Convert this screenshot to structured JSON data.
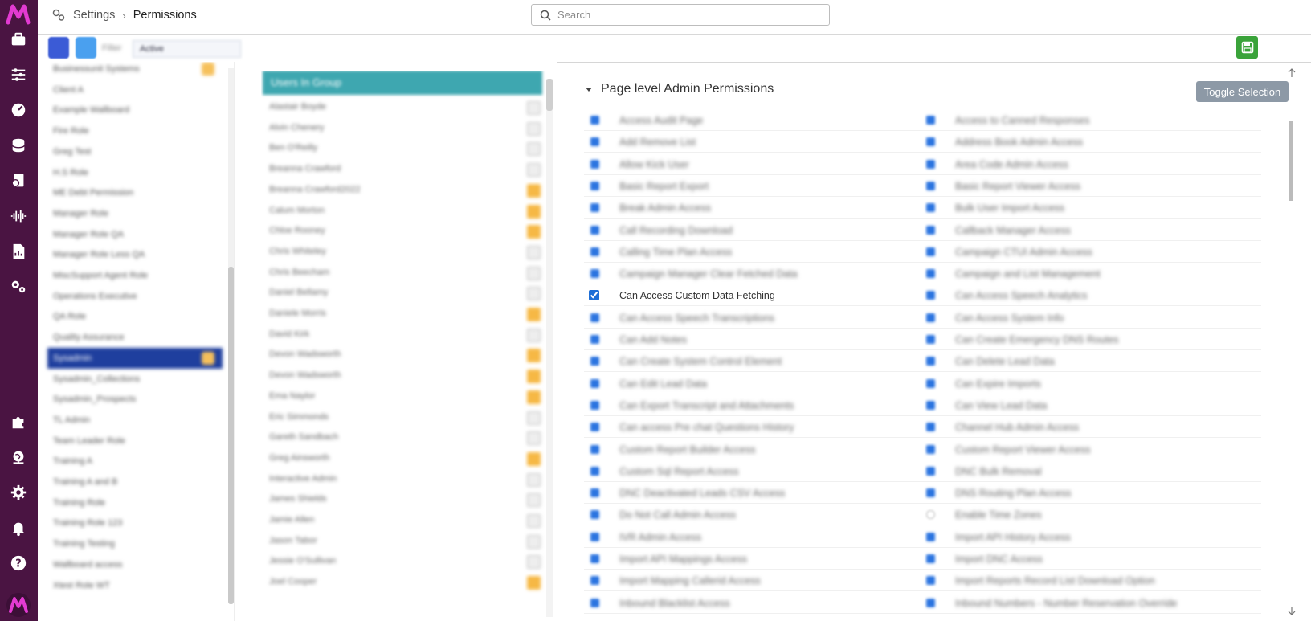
{
  "header": {
    "breadcrumb_root": "Settings",
    "breadcrumb_separator": "›",
    "breadcrumb_current": "Permissions",
    "search_placeholder": "Search"
  },
  "toolbar": {
    "filter_label": "Filter",
    "filter_value": "Active"
  },
  "rail_icons": [
    "briefcase-icon",
    "sliders-icon",
    "dashboard-icon",
    "database-icon",
    "reports-icon",
    "audio-wave-icon",
    "chart-document-icon",
    "cogs-icon",
    "puzzle-icon",
    "globe-icon",
    "settings-icon",
    "bell-icon",
    "help-icon"
  ],
  "groups": [
    {
      "label": "Businessunit Systems",
      "badge": true
    },
    {
      "label": "Client A",
      "badge": false
    },
    {
      "label": "Example Wallboard",
      "badge": false
    },
    {
      "label": "Fire Role",
      "badge": false
    },
    {
      "label": "Greg Test",
      "badge": false
    },
    {
      "label": "H.S Role",
      "badge": false
    },
    {
      "label": "ME Debt Permission",
      "badge": false
    },
    {
      "label": "Manager Role",
      "badge": false
    },
    {
      "label": "Manager Role QA",
      "badge": false
    },
    {
      "label": "Manager Role Less QA",
      "badge": false
    },
    {
      "label": "MiscSupport Agent Role",
      "badge": false
    },
    {
      "label": "Operations Executive",
      "badge": false
    },
    {
      "label": "QA Role",
      "badge": false
    },
    {
      "label": "Quality Assurance",
      "badge": false
    },
    {
      "label": "Sysadmin",
      "badge": true,
      "selected": true
    },
    {
      "label": "Sysadmin_Collections",
      "badge": false
    },
    {
      "label": "Sysadmin_Prospects",
      "badge": false
    },
    {
      "label": "TL Admin",
      "badge": false
    },
    {
      "label": "Team Leader Role",
      "badge": false
    },
    {
      "label": "Training A",
      "badge": false
    },
    {
      "label": "Training A and B",
      "badge": false
    },
    {
      "label": "Training Role",
      "badge": false
    },
    {
      "label": "Training Role 123",
      "badge": false
    },
    {
      "label": "Training Testing",
      "badge": false
    },
    {
      "label": "Wallboard access",
      "badge": false
    },
    {
      "label": "Xtest Role WT",
      "badge": false
    }
  ],
  "users_panel": {
    "title": "Users In Group",
    "users": [
      {
        "name": "Alastair Boyde",
        "flag": "grey"
      },
      {
        "name": "Alvin Chenery",
        "flag": "grey"
      },
      {
        "name": "Ben O'Reilly",
        "flag": "grey"
      },
      {
        "name": "Breanna Crawford",
        "flag": "grey"
      },
      {
        "name": "Breanna Crawford2022",
        "flag": "orange"
      },
      {
        "name": "Calum Morton",
        "flag": "orange"
      },
      {
        "name": "Chloe Rooney",
        "flag": "orange"
      },
      {
        "name": "Chris Whiteley",
        "flag": "grey"
      },
      {
        "name": "Chris Beecham",
        "flag": "grey"
      },
      {
        "name": "Daniel Bellamy",
        "flag": "grey"
      },
      {
        "name": "Daniele Morris",
        "flag": "orange"
      },
      {
        "name": "David Kirk",
        "flag": "grey"
      },
      {
        "name": "Devon Wadsworth",
        "flag": "orange"
      },
      {
        "name": "Devon Wadsworth",
        "flag": "orange"
      },
      {
        "name": "Ema Naylor",
        "flag": "orange"
      },
      {
        "name": "Eric Simmonds",
        "flag": "grey"
      },
      {
        "name": "Gareth Sandbach",
        "flag": "grey"
      },
      {
        "name": "Greg Ainsworth",
        "flag": "orange"
      },
      {
        "name": "Interactive Admin",
        "flag": "grey"
      },
      {
        "name": "James Shields",
        "flag": "grey"
      },
      {
        "name": "Jamie Allen",
        "flag": "grey"
      },
      {
        "name": "Jason Tabor",
        "flag": "grey"
      },
      {
        "name": "Jessie O'Sullivan",
        "flag": "grey"
      },
      {
        "name": "Joel Cooper",
        "flag": "orange"
      }
    ]
  },
  "permissions": {
    "section_title": "Page level Admin Permissions",
    "toggle_label": "Toggle Selection",
    "left": [
      {
        "label": "Access Audit Page",
        "checked": true
      },
      {
        "label": "Add Remove List",
        "checked": true
      },
      {
        "label": "Allow Kick User",
        "checked": true
      },
      {
        "label": "Basic Report Export",
        "checked": true
      },
      {
        "label": "Break Admin Access",
        "checked": true
      },
      {
        "label": "Call Recording Download",
        "checked": true
      },
      {
        "label": "Calling Time Plan Access",
        "checked": true
      },
      {
        "label": "Campaign Manager Clear Fetched Data",
        "checked": true
      },
      {
        "label": "Can Access Custom Data Fetching",
        "checked": true,
        "clear": true
      },
      {
        "label": "Can Access Speech Transcriptions",
        "checked": true
      },
      {
        "label": "Can Add Notes",
        "checked": true
      },
      {
        "label": "Can Create System Control Element",
        "checked": true
      },
      {
        "label": "Can Edit Lead Data",
        "checked": true
      },
      {
        "label": "Can Export Transcript and Attachments",
        "checked": true
      },
      {
        "label": "Can access Pre chat Questions History",
        "checked": true
      },
      {
        "label": "Custom Report Builder Access",
        "checked": true
      },
      {
        "label": "Custom Sql Report Access",
        "checked": true
      },
      {
        "label": "DNC Deactivated Leads CSV Access",
        "checked": true
      },
      {
        "label": "Do Not Call Admin Access",
        "checked": true
      },
      {
        "label": "IVR Admin Access",
        "checked": true
      },
      {
        "label": "Import API Mappings Access",
        "checked": true
      },
      {
        "label": "Import Mapping Callerid Access",
        "checked": true
      },
      {
        "label": "Inbound Blacklist Access",
        "checked": true
      }
    ],
    "right": [
      {
        "label": "Access to Canned Responses",
        "checked": true
      },
      {
        "label": "Address Book Admin Access",
        "checked": true
      },
      {
        "label": "Area Code Admin Access",
        "checked": true
      },
      {
        "label": "Basic Report Viewer Access",
        "checked": true
      },
      {
        "label": "Bulk User Import Access",
        "checked": true
      },
      {
        "label": "Callback Manager Access",
        "checked": true
      },
      {
        "label": "Campaign CTUI Admin Access",
        "checked": true
      },
      {
        "label": "Campaign and List Management",
        "checked": true
      },
      {
        "label": "Can Access Speech Analytics",
        "checked": true
      },
      {
        "label": "Can Access System Info",
        "checked": true
      },
      {
        "label": "Can Create Emergency DNS Routes",
        "checked": true
      },
      {
        "label": "Can Delete Lead Data",
        "checked": true
      },
      {
        "label": "Can Expire Imports",
        "checked": true
      },
      {
        "label": "Can View Lead Data",
        "checked": true
      },
      {
        "label": "Channel Hub Admin Access",
        "checked": true
      },
      {
        "label": "Custom Report Viewer Access",
        "checked": true
      },
      {
        "label": "DNC Bulk Removal",
        "checked": true
      },
      {
        "label": "DNS Routing Plan Access",
        "checked": true
      },
      {
        "label": "Enable Time Zones",
        "checked": false
      },
      {
        "label": "Import API History Access",
        "checked": true
      },
      {
        "label": "Import DNC Access",
        "checked": true
      },
      {
        "label": "Import Reports Record List Download Option",
        "checked": true
      },
      {
        "label": "Inbound Numbers - Number Reservation Override",
        "checked": true
      }
    ]
  },
  "colors": {
    "rail": "#4a1442",
    "brand_logo": "#e23ad1",
    "selected_group": "#1f3f9e",
    "users_header": "#3ea7b0",
    "save_green": "#3aa33a",
    "checkbox_blue": "#2b74e0",
    "toggle_button": "#8d99a6"
  }
}
